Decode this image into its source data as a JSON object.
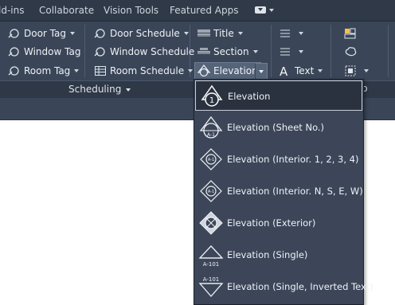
{
  "tabs": [
    "ld-ins",
    "Collaborate",
    "Vision Tools",
    "Featured Apps"
  ],
  "ribbon": {
    "col1": [
      "Door Tag",
      "Window Tag",
      "Room Tag"
    ],
    "col2": [
      "Door Schedule",
      "Window Schedule",
      "Room Schedule"
    ],
    "col3": [
      "Title",
      "Section",
      "Elevation"
    ],
    "col4_text": "Text",
    "panel_title": "Scheduling",
    "partial_panel_title": "p"
  },
  "menu": {
    "items": [
      {
        "label": "Elevation",
        "icon_name": "elevation-icon",
        "glyph": "1"
      },
      {
        "label": "Elevation (Sheet No.)",
        "icon_name": "elevation-sheet-no-icon",
        "glyph": "A-1"
      },
      {
        "label": "Elevation (Interior. 1, 2, 3, 4)",
        "icon_name": "elevation-interior-numbered-icon",
        "glyph": "A-1"
      },
      {
        "label": "Elevation (Interior. N, S, E, W)",
        "icon_name": "elevation-interior-compass-icon",
        "glyph": "A-1"
      },
      {
        "label": "Elevation (Exterior)",
        "icon_name": "elevation-exterior-icon",
        "glyph": ""
      },
      {
        "label": "Elevation (Single)",
        "icon_name": "elevation-single-icon",
        "glyph": "A-101"
      },
      {
        "label": "Elevation (Single, Inverted Text)",
        "icon_name": "elevation-single-inverted-icon",
        "glyph": "A-101"
      }
    ],
    "selected_index": 0
  },
  "colors": {
    "ribbon": "#3a4658",
    "tabbar": "#2f3947",
    "menu_bg": "#3d4659",
    "selected_bg": "#2b323f",
    "text": "#eef1f5"
  }
}
